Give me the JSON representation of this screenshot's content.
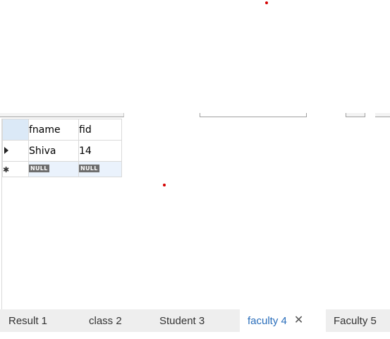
{
  "result_grid": {
    "columns": [
      "fname",
      "fid"
    ],
    "rows": [
      {
        "fname": "Shiva",
        "fid": "14"
      }
    ],
    "new_row": {
      "fname": "NULL",
      "fid": "NULL"
    },
    "new_row_marker": "✱",
    "current_row_icon": "current-row-arrow-icon"
  },
  "tabs": [
    {
      "label": "Result 1",
      "active": false
    },
    {
      "label": "class 2",
      "active": false
    },
    {
      "label": "Student 3",
      "active": false
    },
    {
      "label": "faculty 4",
      "active": true
    },
    {
      "label": "Faculty 5",
      "active": false
    }
  ],
  "active_tab_close": "✕",
  "colors": {
    "active_tab_text": "#2a6ebb",
    "tabbar_background": "#eeeeee",
    "header_corner": "#dbe9f7",
    "new_row_background": "#eaf2fc",
    "null_badge": "#6e6e6e",
    "cursor_dot": "#d40000"
  }
}
